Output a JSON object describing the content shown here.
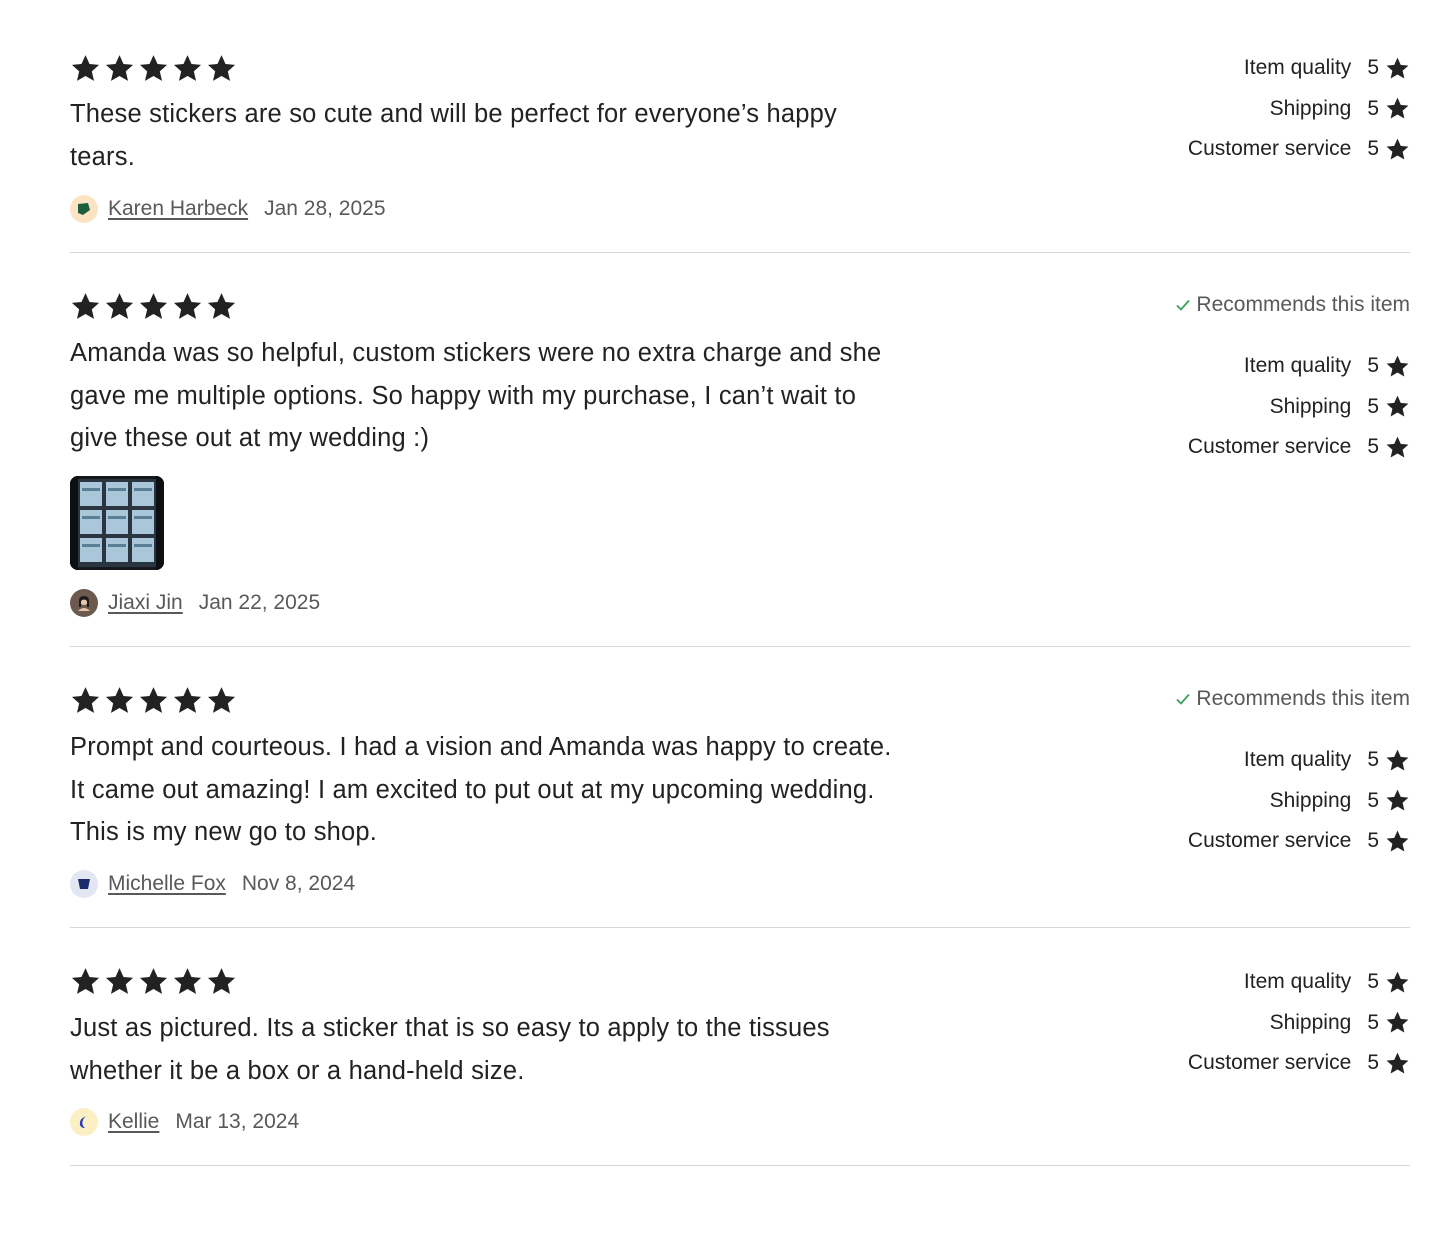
{
  "colors": {
    "star": "#222222",
    "check": "#3aa05a",
    "divider": "#d6d6d6",
    "muted": "#595959"
  },
  "rating_labels": [
    "Item quality",
    "Shipping",
    "Customer service"
  ],
  "reviews": [
    {
      "stars": 5,
      "text": "These stickers are so cute and will be perfect for everyone’s happy tears.",
      "reviewer": "Karen Harbeck",
      "date": "Jan 28, 2025",
      "avatar_icon": "green-leaf-icon",
      "recommends": null,
      "has_photo": false,
      "ratings": [
        {
          "label": "Item quality",
          "value": "5"
        },
        {
          "label": "Shipping",
          "value": "5"
        },
        {
          "label": "Customer service",
          "value": "5"
        }
      ]
    },
    {
      "stars": 5,
      "text": "Amanda was so helpful, custom stickers were no extra charge and she gave me multiple options. So happy with my purchase, I can’t wait to give these out at my wedding :)",
      "reviewer": "Jiaxi Jin",
      "date": "Jan 22, 2025",
      "avatar_icon": "profile-photo-icon",
      "recommends": "Recommends this item",
      "has_photo": true,
      "ratings": [
        {
          "label": "Item quality",
          "value": "5"
        },
        {
          "label": "Shipping",
          "value": "5"
        },
        {
          "label": "Customer service",
          "value": "5"
        }
      ]
    },
    {
      "stars": 5,
      "text": "Prompt and courteous. I had a vision and Amanda was happy to create. It came out amazing! I am excited to put out at my upcoming wedding. This is my new go to shop.",
      "reviewer": "Michelle Fox",
      "date": "Nov 8, 2024",
      "avatar_icon": "navy-shape-icon",
      "recommends": "Recommends this item",
      "has_photo": false,
      "ratings": [
        {
          "label": "Item quality",
          "value": "5"
        },
        {
          "label": "Shipping",
          "value": "5"
        },
        {
          "label": "Customer service",
          "value": "5"
        }
      ]
    },
    {
      "stars": 5,
      "text": "Just as pictured. Its a sticker that is so easy to apply to the tissues whether it be a box or a hand-held size.",
      "reviewer": "Kellie",
      "date": "Mar 13, 2024",
      "avatar_icon": "blue-crescent-icon",
      "recommends": null,
      "has_photo": false,
      "ratings": [
        {
          "label": "Item quality",
          "value": "5"
        },
        {
          "label": "Shipping",
          "value": "5"
        },
        {
          "label": "Customer service",
          "value": "5"
        }
      ]
    }
  ]
}
